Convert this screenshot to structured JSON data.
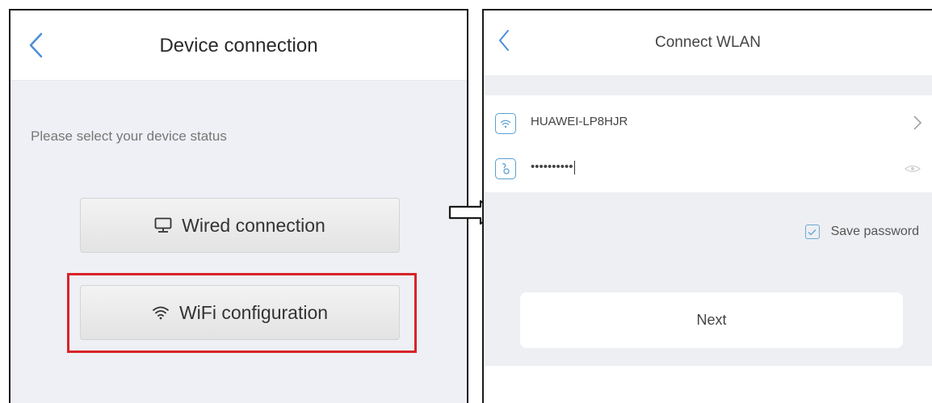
{
  "left_screen": {
    "title": "Device connection",
    "prompt": "Please select your device status",
    "wired_label": "Wired connection",
    "wifi_label": "WiFi configuration"
  },
  "right_screen": {
    "title": "Connect WLAN",
    "ssid": "HUAWEI-LP8HJR",
    "password_masked": "••••••••••",
    "save_password_label": "Save password",
    "save_password_checked": true,
    "next_label": "Next"
  },
  "icons": {
    "back": "chevron-left-icon",
    "wired": "monitor-icon",
    "wifi": "wifi-icon",
    "ssid": "wifi-icon",
    "password": "lock-icon",
    "show_password": "eye-icon",
    "ssid_more": "chevron-right-icon",
    "transition": "arrow-right-icon"
  },
  "colors": {
    "accent_blue": "#4a90d9",
    "highlight_red": "#d8232a",
    "left_background": "#eef0f5",
    "right_background": "#eeeff2"
  }
}
